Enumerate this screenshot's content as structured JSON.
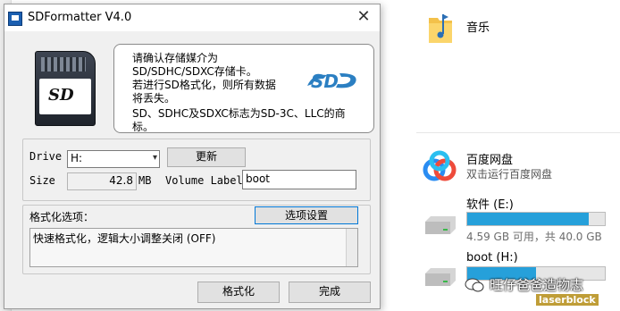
{
  "window": {
    "title": "SDFormatter V4.0",
    "close_glyph": "✕"
  },
  "info": {
    "message": "请确认存储媒介为SD/SDHC/SDXC存储卡。若进行SD格式化，则所有数据将丢失。",
    "message_lines": [
      "请确认存储媒介为",
      "SD/SDHC/SDXC存储卡。",
      "若进行SD格式化，则所有数据",
      "将丢失。"
    ],
    "trademark_lines": [
      "SD、SDHC及SDXC标志为SD-3C、LLC的商",
      "标。"
    ],
    "card_label": "SD",
    "logo_icon": "sd-logo-icon"
  },
  "drive": {
    "label": "Drive",
    "selected": "H:",
    "refresh_button": "更新"
  },
  "size": {
    "label": "Size",
    "value": "42.8",
    "unit": "MB"
  },
  "volume": {
    "label": "Volume Label",
    "value": "boot"
  },
  "format_options": {
    "label": "格式化选项：",
    "settings_button": "选项设置",
    "current": "快速格式化，逻辑大小调整关闭 (OFF)"
  },
  "actions": {
    "format_button": "格式化",
    "done_button": "完成"
  },
  "explorer": {
    "music": {
      "label": "音乐",
      "icon": "music-folder-icon"
    },
    "baidu": {
      "title": "百度网盘",
      "subtitle": "双击运行百度网盘",
      "icon": "baidu-netdisk-icon"
    },
    "drive_e": {
      "label": "软件 (E:)",
      "info": "4.59 GB 可用，共 40.0 GB",
      "used_fraction": 0.885
    },
    "drive_h": {
      "label": "boot (H:)",
      "used_fraction": 0.5
    }
  },
  "watermark": {
    "text": "旺仔爸爸造物志",
    "sub": "laserblock"
  },
  "colors": {
    "accent": "#0078d7",
    "progress": "#26a0da"
  }
}
